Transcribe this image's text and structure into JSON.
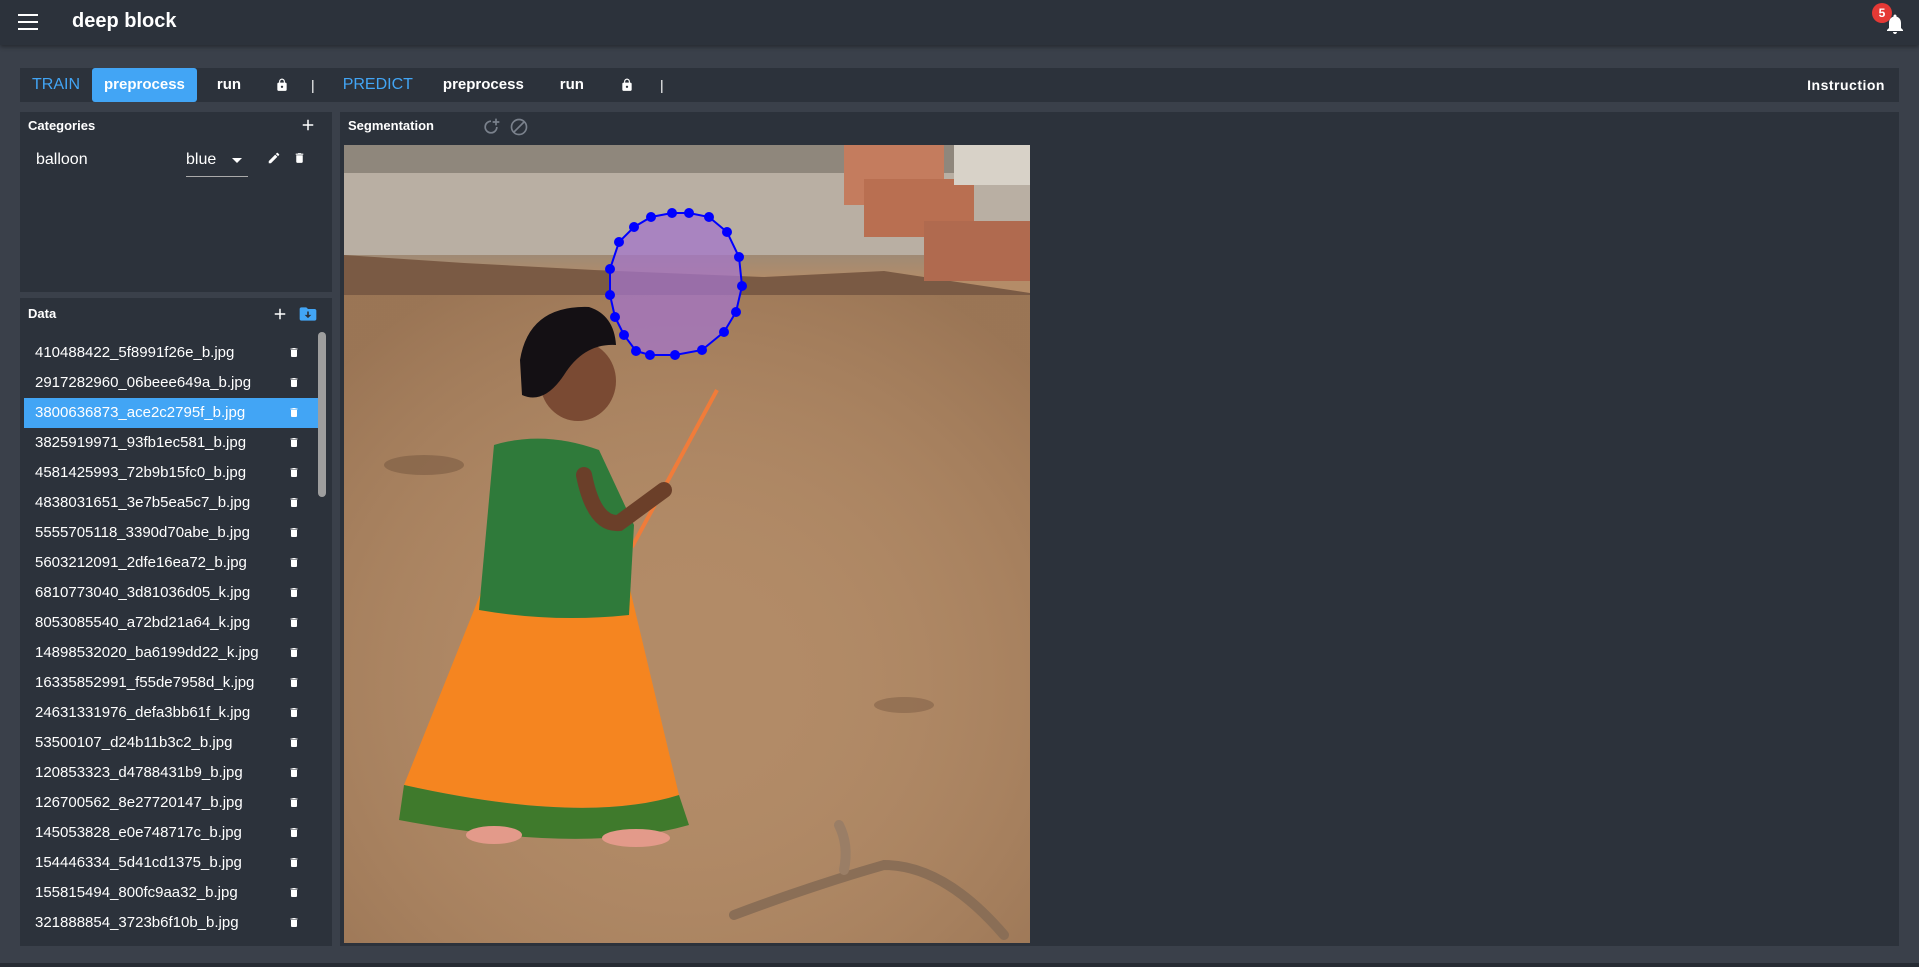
{
  "app": {
    "title": "deep block",
    "notification_count": "5"
  },
  "toolbar": {
    "train_label": "TRAIN",
    "train_preprocess": "preprocess",
    "train_run": "run",
    "separator": "|",
    "predict_label": "PREDICT",
    "predict_preprocess": "preprocess",
    "predict_run": "run",
    "instruction": "Instruction"
  },
  "categories": {
    "title": "Categories",
    "items": [
      {
        "name": "balloon",
        "color": "blue"
      }
    ]
  },
  "data": {
    "title": "Data",
    "selected": "3800636873_ace2c2795f_b.jpg",
    "files": [
      "410488422_5f8991f26e_b.jpg",
      "2917282960_06beee649a_b.jpg",
      "3800636873_ace2c2795f_b.jpg",
      "3825919971_93fb1ec581_b.jpg",
      "4581425993_72b9b15fc0_b.jpg",
      "4838031651_3e7b5ea5c7_b.jpg",
      "5555705118_3390d70abe_b.jpg",
      "5603212091_2dfe16ea72_b.jpg",
      "6810773040_3d81036d05_k.jpg",
      "8053085540_a72bd21a64_k.jpg",
      "14898532020_ba6199dd22_k.jpg",
      "16335852991_f55de7958d_k.jpg",
      "24631331976_defa3bb61f_k.jpg",
      "53500107_d24b11b3c2_b.jpg",
      "120853323_d4788431b9_b.jpg",
      "126700562_8e27720147_b.jpg",
      "145053828_e0e748717c_b.jpg",
      "154446334_5d41cd1375_b.jpg",
      "155815494_800fc9aa32_b.jpg",
      "321888854_3723b6f10b_b.jpg"
    ]
  },
  "segmentation": {
    "title": "Segmentation"
  },
  "colors": {
    "accent": "#42a5f5",
    "panel": "#2c323b",
    "background": "#3a404a",
    "polygon": "#0000ff",
    "badge": "#e53935"
  },
  "icons": [
    "menu-icon",
    "bell-icon",
    "lock-icon",
    "add-icon",
    "edit-icon",
    "delete-icon",
    "folder-download-icon",
    "auto-segment-icon",
    "block-icon"
  ]
}
